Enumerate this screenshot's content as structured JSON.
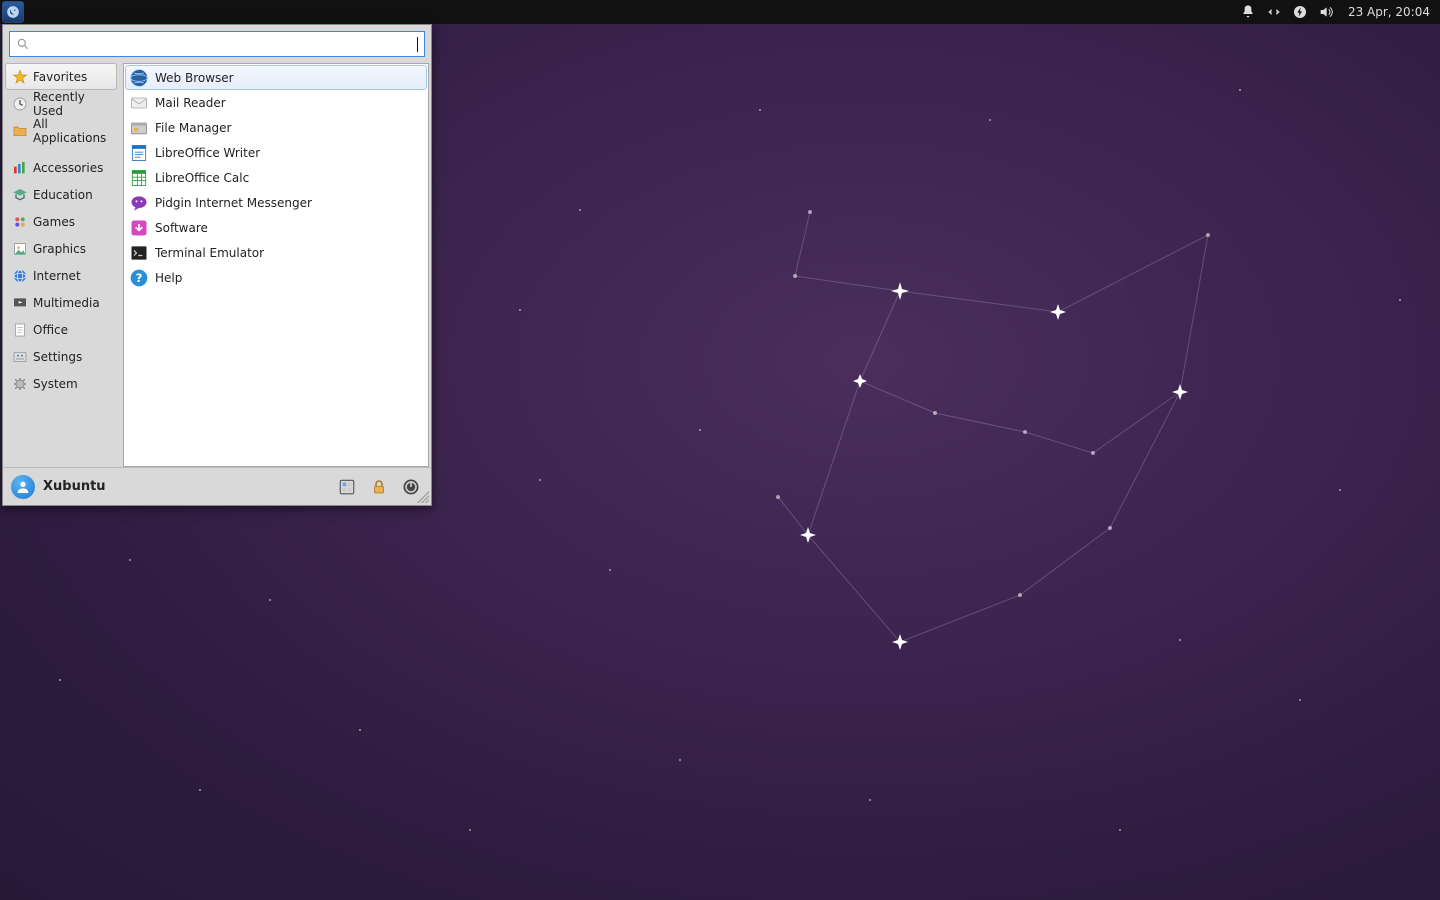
{
  "panel": {
    "clock": "23 Apr, 20:04"
  },
  "menu": {
    "search_placeholder": "",
    "sidebar": {
      "primary": [
        {
          "label": "Favorites",
          "icon": "star",
          "selected": true
        },
        {
          "label": "Recently Used",
          "icon": "clock"
        },
        {
          "label": "All Applications",
          "icon": "folder"
        }
      ],
      "categories": [
        {
          "label": "Accessories",
          "icon": "accessories"
        },
        {
          "label": "Education",
          "icon": "education"
        },
        {
          "label": "Games",
          "icon": "games"
        },
        {
          "label": "Graphics",
          "icon": "graphics"
        },
        {
          "label": "Internet",
          "icon": "internet"
        },
        {
          "label": "Multimedia",
          "icon": "multimedia"
        },
        {
          "label": "Office",
          "icon": "office"
        },
        {
          "label": "Settings",
          "icon": "settings"
        },
        {
          "label": "System",
          "icon": "system"
        }
      ]
    },
    "apps": [
      {
        "label": "Web Browser",
        "icon": "globe",
        "hover": true
      },
      {
        "label": "Mail Reader",
        "icon": "mail"
      },
      {
        "label": "File Manager",
        "icon": "filemanager"
      },
      {
        "label": "LibreOffice Writer",
        "icon": "writer"
      },
      {
        "label": "LibreOffice Calc",
        "icon": "calc"
      },
      {
        "label": "Pidgin Internet Messenger",
        "icon": "pidgin"
      },
      {
        "label": "Software",
        "icon": "software"
      },
      {
        "label": "Terminal Emulator",
        "icon": "terminal"
      },
      {
        "label": "Help",
        "icon": "help"
      }
    ],
    "footer": {
      "user": "Xubuntu"
    }
  }
}
